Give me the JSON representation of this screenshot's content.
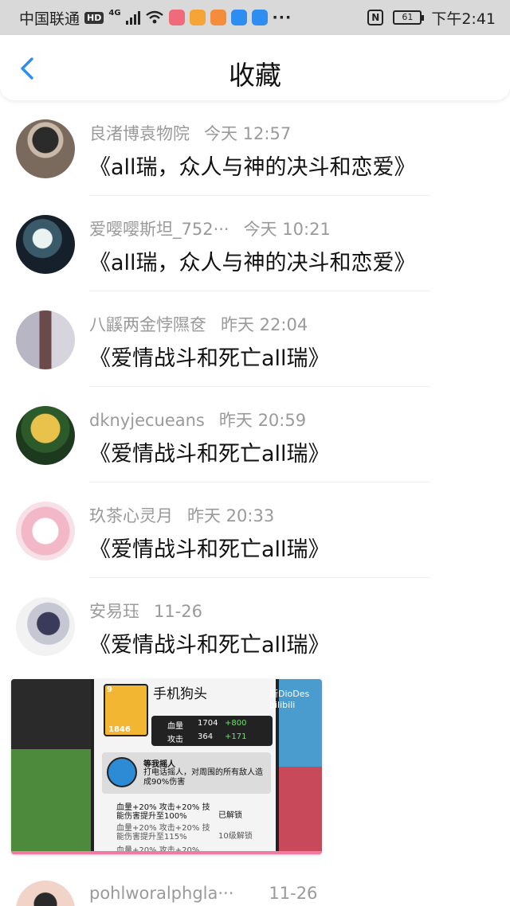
{
  "status_bar": {
    "carrier": "中国联通",
    "hd_badge": "HD",
    "network": "4G",
    "dots": "···",
    "nfc": "N",
    "battery": "61",
    "time": "下午2:41",
    "app_icons": [
      "#ef6a7a",
      "#f7a437",
      "#f58c3c",
      "#2f8df2",
      "#2f8df2"
    ]
  },
  "header": {
    "title": "收藏",
    "back_icon": "chevron-left-icon",
    "accent": "#2f8df2"
  },
  "favorites": [
    {
      "name": "良渚博袁物院",
      "time": "今天  12:57",
      "title": "《all瑞，众人与神的决斗和恋爱》"
    },
    {
      "name": "爱嘤嘤斯坦_752···",
      "time": "今天  10:21",
      "title": "《all瑞，众人与神的决斗和恋爱》"
    },
    {
      "name": "八鼷两金悖隰奁",
      "time": "昨天  22:04",
      "title": "《爱情战斗和死亡all瑞》"
    },
    {
      "name": "dknyjecueans",
      "time": "昨天  20:59",
      "title": "《爱情战斗和死亡all瑞》"
    },
    {
      "name": "玖茶心灵月",
      "time": "昨天  20:33",
      "title": "《爱情战斗和死亡all瑞》"
    },
    {
      "name": "安易珏",
      "time": "11-26",
      "title": "《爱情战斗和死亡all瑞》"
    }
  ],
  "media_thumb": {
    "card_name": "手机狗头",
    "level": "9",
    "hp_label": "血量",
    "hp_value": "1704",
    "hp_bonus": "+800",
    "atk_label": "攻击",
    "atk_value": "364",
    "atk_bonus": "+171",
    "coin": "1846",
    "skill_name": "等我摇人",
    "skill_desc": "打电话摇人，对周围的所有敌人造成90%伤害",
    "upgrade_1": "血量+20% 攻击+20% 技能伤害提升至100%",
    "upgrade_1_state": "已解锁",
    "upgrade_2": "血量+20% 攻击+20% 技能伤害提升至115%",
    "upgrade_2_state": "10级解锁",
    "upgrade_3": "血量+20% 攻击+20%",
    "watermark": "斯DioDes bilibili"
  },
  "partial_item": {
    "name": "pohlworalphgla···",
    "time": "11-26"
  }
}
